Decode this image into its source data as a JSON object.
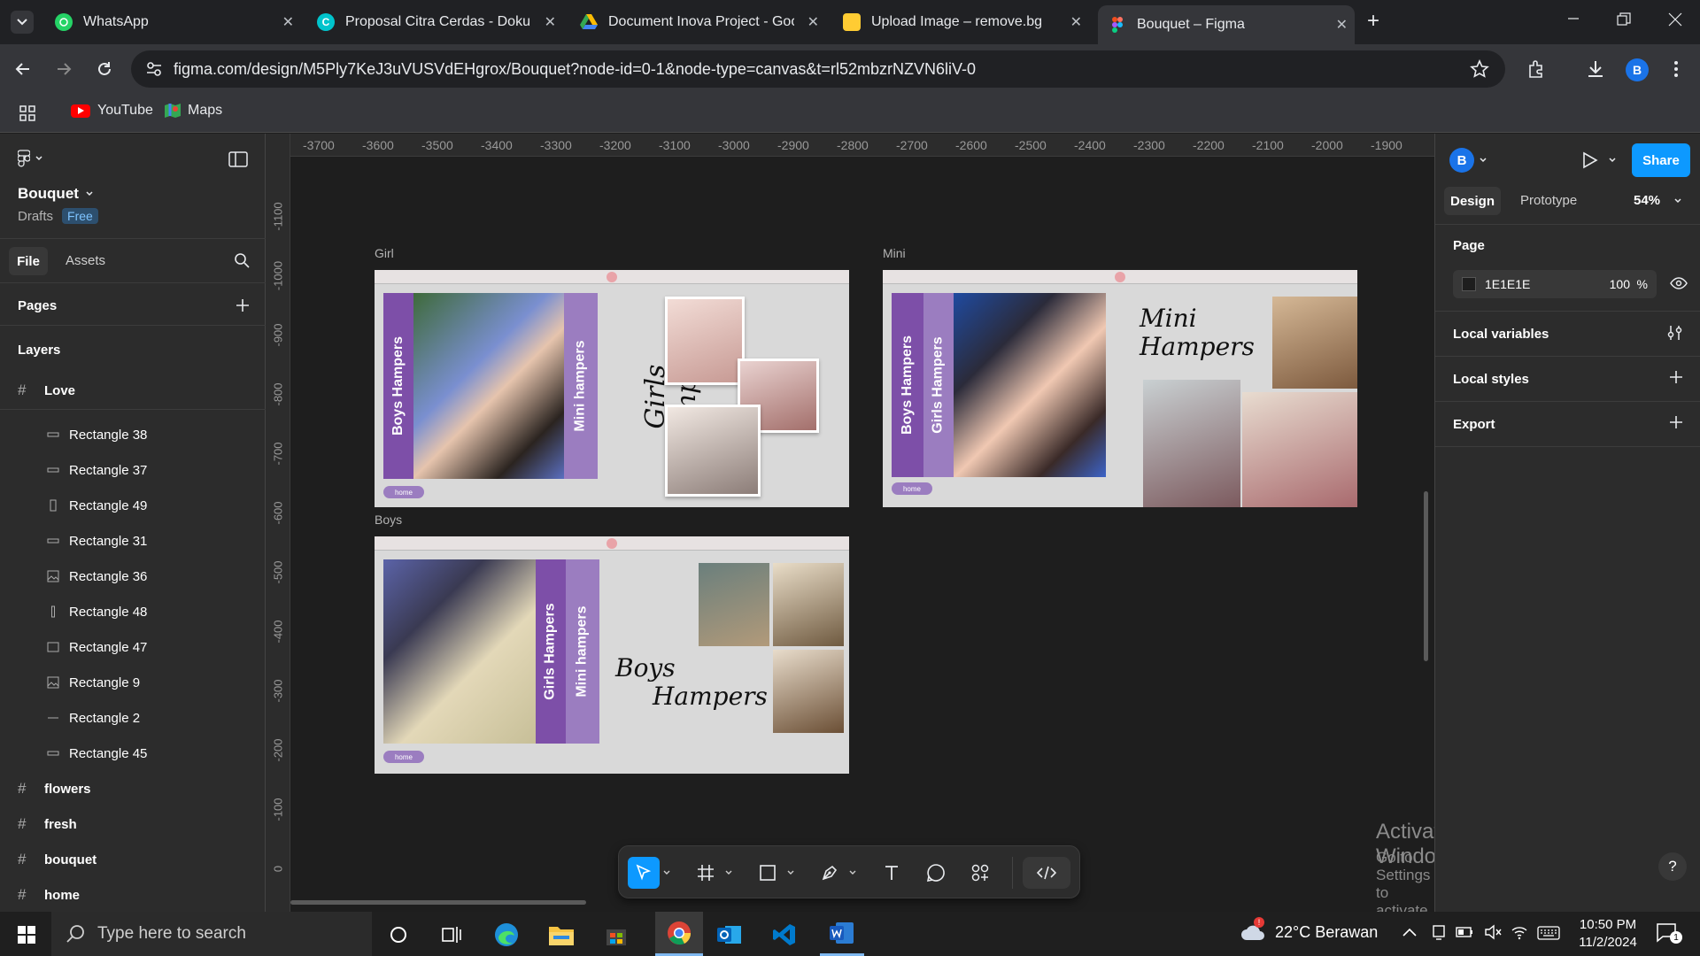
{
  "browser": {
    "tabs": [
      {
        "title": "WhatsApp",
        "icon": "whatsapp-icon",
        "color": "#25d366"
      },
      {
        "title": "Proposal Citra Cerdas - Dokume",
        "icon": "canva-icon",
        "color": "#00c4cc"
      },
      {
        "title": "Document Inova Project - Goog",
        "icon": "google-drive-icon",
        "color": "#fbbc04"
      },
      {
        "title": "Upload Image – remove.bg",
        "icon": "removebg-icon",
        "color": "#ffcc33"
      },
      {
        "title": "Bouquet – Figma",
        "icon": "figma-icon",
        "color": "#f24e1e",
        "active": true
      }
    ],
    "url": "figma.com/design/M5Ply7KeJ3uVUSVdEHgrox/Bouquet?node-id=0-1&node-type=canvas&t=rl52mbzrNZVN6liV-0",
    "profile_initial": "B",
    "bookmarks": [
      {
        "label": "YouTube",
        "icon": "youtube-icon"
      },
      {
        "label": "Maps",
        "icon": "maps-icon"
      }
    ]
  },
  "left_panel": {
    "file_name": "Bouquet",
    "drafts_label": "Drafts",
    "plan_badge": "Free",
    "tabs": {
      "file": "File",
      "assets": "Assets"
    },
    "pages_label": "Pages",
    "layers_label": "Layers",
    "top_frame": "Love",
    "layers": [
      {
        "name": "Rectangle 38",
        "icon": "rectangle-wide-icon"
      },
      {
        "name": "Rectangle 37",
        "icon": "rectangle-wide-icon"
      },
      {
        "name": "Rectangle 49",
        "icon": "rectangle-tall-icon"
      },
      {
        "name": "Rectangle 31",
        "icon": "rectangle-wide-icon"
      },
      {
        "name": "Rectangle 36",
        "icon": "image-icon"
      },
      {
        "name": "Rectangle 48",
        "icon": "rectangle-thin-icon"
      },
      {
        "name": "Rectangle 47",
        "icon": "rectangle-icon"
      },
      {
        "name": "Rectangle 9",
        "icon": "image-icon"
      },
      {
        "name": "Rectangle 2",
        "icon": "line-icon"
      },
      {
        "name": "Rectangle 45",
        "icon": "rectangle-wide-icon"
      }
    ],
    "frames": [
      "flowers",
      "fresh",
      "bouquet",
      "home"
    ]
  },
  "canvas": {
    "ruler_x": [
      "-3700",
      "-3600",
      "-3500",
      "-3400",
      "-3300",
      "-3200",
      "-3100",
      "-3000",
      "-2900",
      "-2800",
      "-2700",
      "-2600",
      "-2500",
      "-2400",
      "-2300",
      "-2200",
      "-2100",
      "-2000",
      "-1900"
    ],
    "ruler_y": [
      "-1100",
      "-1000",
      "-900",
      "-800",
      "-700",
      "-600",
      "-500",
      "-400",
      "-300",
      "-200",
      "-100",
      "0"
    ],
    "frames": {
      "girl": {
        "label": "Girl",
        "bar1": "Boys Hampers",
        "bar2": "Mini hampers",
        "script": "Girls Hampers",
        "home": "home"
      },
      "mini": {
        "label": "Mini",
        "bar1": "Boys Hampers",
        "bar2": "Girls Hampers",
        "script_line1": "Mini",
        "script_line2": "Hampers",
        "home": "home"
      },
      "boys": {
        "label": "Boys",
        "bar1": "Girls Hampers",
        "bar2": "Mini hampers",
        "script_line1": "Boys",
        "script_line2": "Hampers",
        "home": "home"
      }
    },
    "watermark_title": "Activate Windows",
    "watermark_sub": "Go to Settings to activate Windows."
  },
  "right_panel": {
    "avatar": "B",
    "share_label": "Share",
    "tabs": {
      "design": "Design",
      "prototype": "Prototype"
    },
    "zoom": "54%",
    "page_label": "Page",
    "page_color": "1E1E1E",
    "page_opacity": "100",
    "percent": "%",
    "local_variables": "Local variables",
    "local_styles": "Local styles",
    "export": "Export"
  },
  "taskbar": {
    "search_placeholder": "Type here to search",
    "weather": "22°C  Berawan",
    "time": "10:50 PM",
    "date": "11/2/2024",
    "notification_count": "1"
  },
  "colors": {
    "figma_blue": "#0d99ff",
    "purple": "#7d4fa8",
    "purple_light": "#9b7dc0",
    "canvas_bg": "#1e1e1e"
  }
}
